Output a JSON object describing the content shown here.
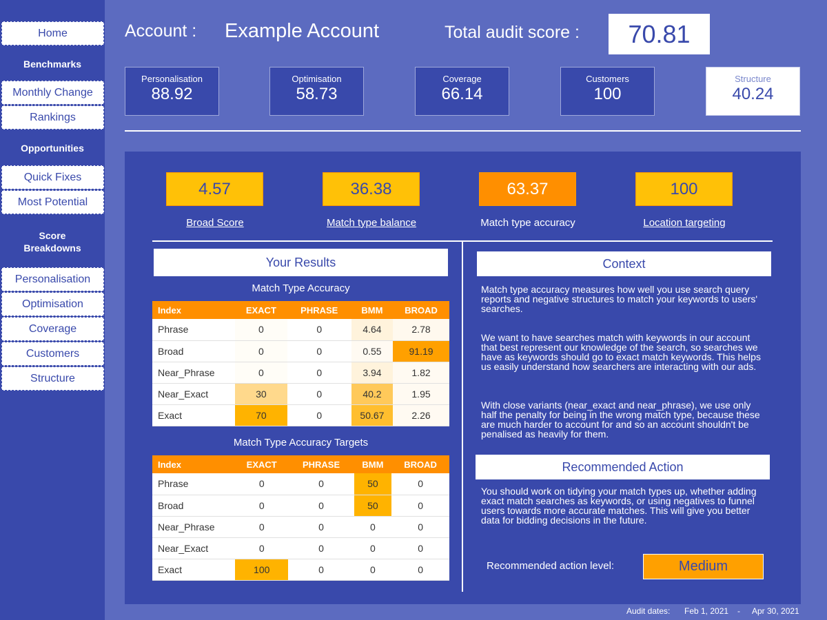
{
  "sidebar": {
    "home": "Home",
    "benchmarks": "Benchmarks",
    "monthly_change": "Monthly Change",
    "rankings": "Rankings",
    "opportunities": "Opportunities",
    "quick_fixes": "Quick Fixes",
    "most_potential": "Most Potential",
    "score_breakdowns": "Score Breakdowns",
    "personalisation": "Personalisation",
    "optimisation": "Optimisation",
    "coverage": "Coverage",
    "customers": "Customers",
    "structure": "Structure"
  },
  "header": {
    "account_label": "Account :",
    "account_name": "Example Account",
    "total_label": "Total audit score :",
    "total_score": "70.81"
  },
  "kpis": [
    {
      "label": "Personalisation",
      "value": "88.92"
    },
    {
      "label": "Optimisation",
      "value": "58.73"
    },
    {
      "label": "Coverage",
      "value": "66.14"
    },
    {
      "label": "Customers",
      "value": "100"
    },
    {
      "label": "Structure",
      "value": "40.24"
    }
  ],
  "metrics": [
    {
      "value": "4.57",
      "label": "Broad Score"
    },
    {
      "value": "36.38",
      "label": "Match type balance"
    },
    {
      "value": "63.37",
      "label": "Match type accuracy"
    },
    {
      "value": "100",
      "label": "Location targeting"
    }
  ],
  "results": {
    "title": "Your Results",
    "table1_title": "Match Type Accuracy",
    "table2_title": "Match Type Accuracy Targets",
    "headers": [
      "Index",
      "EXACT",
      "PHRASE",
      "BMM",
      "BROAD"
    ],
    "accuracy": [
      [
        "Phrase",
        "0",
        "0",
        "4.64",
        "2.78"
      ],
      [
        "Broad",
        "0",
        "0",
        "0.55",
        "91.19"
      ],
      [
        "Near_Phrase",
        "0",
        "0",
        "3.94",
        "1.82"
      ],
      [
        "Near_Exact",
        "30",
        "0",
        "40.2",
        "1.95"
      ],
      [
        "Exact",
        "70",
        "0",
        "50.67",
        "2.26"
      ]
    ],
    "targets": [
      [
        "Phrase",
        "0",
        "0",
        "50",
        "0"
      ],
      [
        "Broad",
        "0",
        "0",
        "50",
        "0"
      ],
      [
        "Near_Phrase",
        "0",
        "0",
        "0",
        "0"
      ],
      [
        "Near_Exact",
        "0",
        "0",
        "0",
        "0"
      ],
      [
        "Exact",
        "100",
        "0",
        "0",
        "0"
      ]
    ]
  },
  "context": {
    "title": "Context",
    "p1": "Match type accuracy measures how well you use search query reports and negative structures to match your keywords to users' searches.",
    "p2": "We want to have searches match with keywords in our account that best represent our knowledge of the search, so searches we have as keywords should go to exact match keywords. This helps us easily understand how searchers are interacting with our ads.",
    "p3": "With close variants (near_exact and near_phrase), we use only half the penalty for being in the wrong match type, because these are much harder to account for and so an account shouldn't be penalised as heavily for them."
  },
  "recommended": {
    "title": "Recommended Action",
    "text": "You should work on tidying your match types up, whether adding exact match searches as keywords, or using negatives to funnel users towards more accurate matches. This will give you better data for bidding decisions in the future.",
    "level_label": "Recommended action level:",
    "level": "Medium"
  },
  "footer": {
    "label": "Audit dates:",
    "start": "Feb 1, 2021",
    "sep": "-",
    "end": "Apr 30, 2021"
  }
}
